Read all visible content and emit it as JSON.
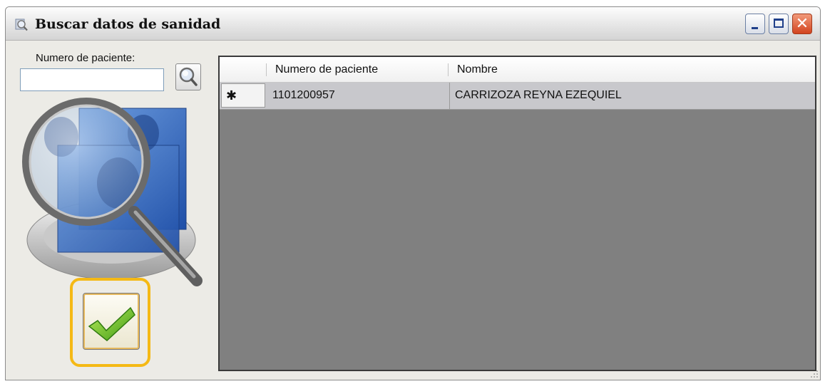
{
  "window": {
    "title": "Buscar datos de sanidad",
    "controls": {
      "minimize": "_",
      "maximize": "□",
      "close": "✕"
    }
  },
  "search": {
    "label": "Numero de paciente:",
    "value": "",
    "placeholder": "",
    "button_icon": "magnifier-icon"
  },
  "illustration": {
    "icon": "search-patient-records-icon"
  },
  "ok_button": {
    "icon": "checkmark-icon",
    "highlight_color": "#f5b915"
  },
  "grid": {
    "columns": [
      "Numero de paciente",
      "Nombre"
    ],
    "rows": [
      {
        "indicator": "✱",
        "numero": "1101200957",
        "nombre": "CARRIZOZA REYNA EZEQUIEL"
      }
    ],
    "background_color": "#808080",
    "row_color": "#c8c8cc"
  }
}
